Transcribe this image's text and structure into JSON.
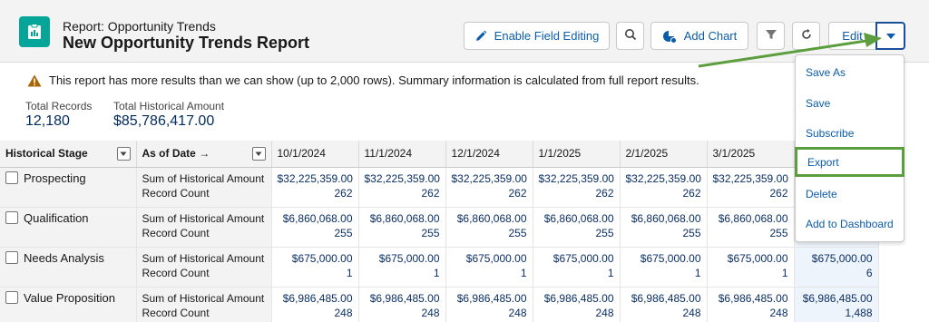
{
  "header": {
    "eyebrow": "Report: Opportunity Trends",
    "title": "New Opportunity Trends Report",
    "buttons": {
      "enable_field_editing": "Enable Field Editing",
      "add_chart": "Add Chart",
      "edit": "Edit"
    }
  },
  "warning": "This report has more results than we can show (up to 2,000 rows). Summary information is calculated from full report results.",
  "summary": [
    {
      "label": "Total Records",
      "value": "12,180"
    },
    {
      "label": "Total Historical Amount",
      "value": "$85,786,417.00"
    }
  ],
  "table": {
    "col_stage": "Historical Stage",
    "col_date": "As of Date",
    "date_arrow": "→",
    "dates": [
      "10/1/2024",
      "11/1/2024",
      "12/1/2024",
      "1/1/2025",
      "2/1/2025",
      "3/1/2025"
    ],
    "measure_amount": "Sum of Historical Amount",
    "measure_count": "Record Count",
    "rows": [
      {
        "stage": "Prospecting",
        "amount": "$32,225,359.00",
        "count": "262",
        "total_amount": "",
        "total_count": ""
      },
      {
        "stage": "Qualification",
        "amount": "$6,860,068.00",
        "count": "255",
        "total_amount": "",
        "total_count": ""
      },
      {
        "stage": "Needs Analysis",
        "amount": "$675,000.00",
        "count": "1",
        "total_amount": "$675,000.00",
        "total_count": "6"
      },
      {
        "stage": "Value Proposition",
        "amount": "$6,986,485.00",
        "count": "248",
        "total_amount": "$6,986,485.00",
        "total_count": "1,488"
      }
    ]
  },
  "menu": {
    "items": [
      "Save As",
      "Save",
      "Subscribe",
      "Export",
      "Delete",
      "Add to Dashboard"
    ],
    "highlighted": "Export"
  },
  "colors": {
    "accent": "#0b5cab",
    "icon_bg": "#06a59a",
    "highlight": "#5c9e3e"
  }
}
